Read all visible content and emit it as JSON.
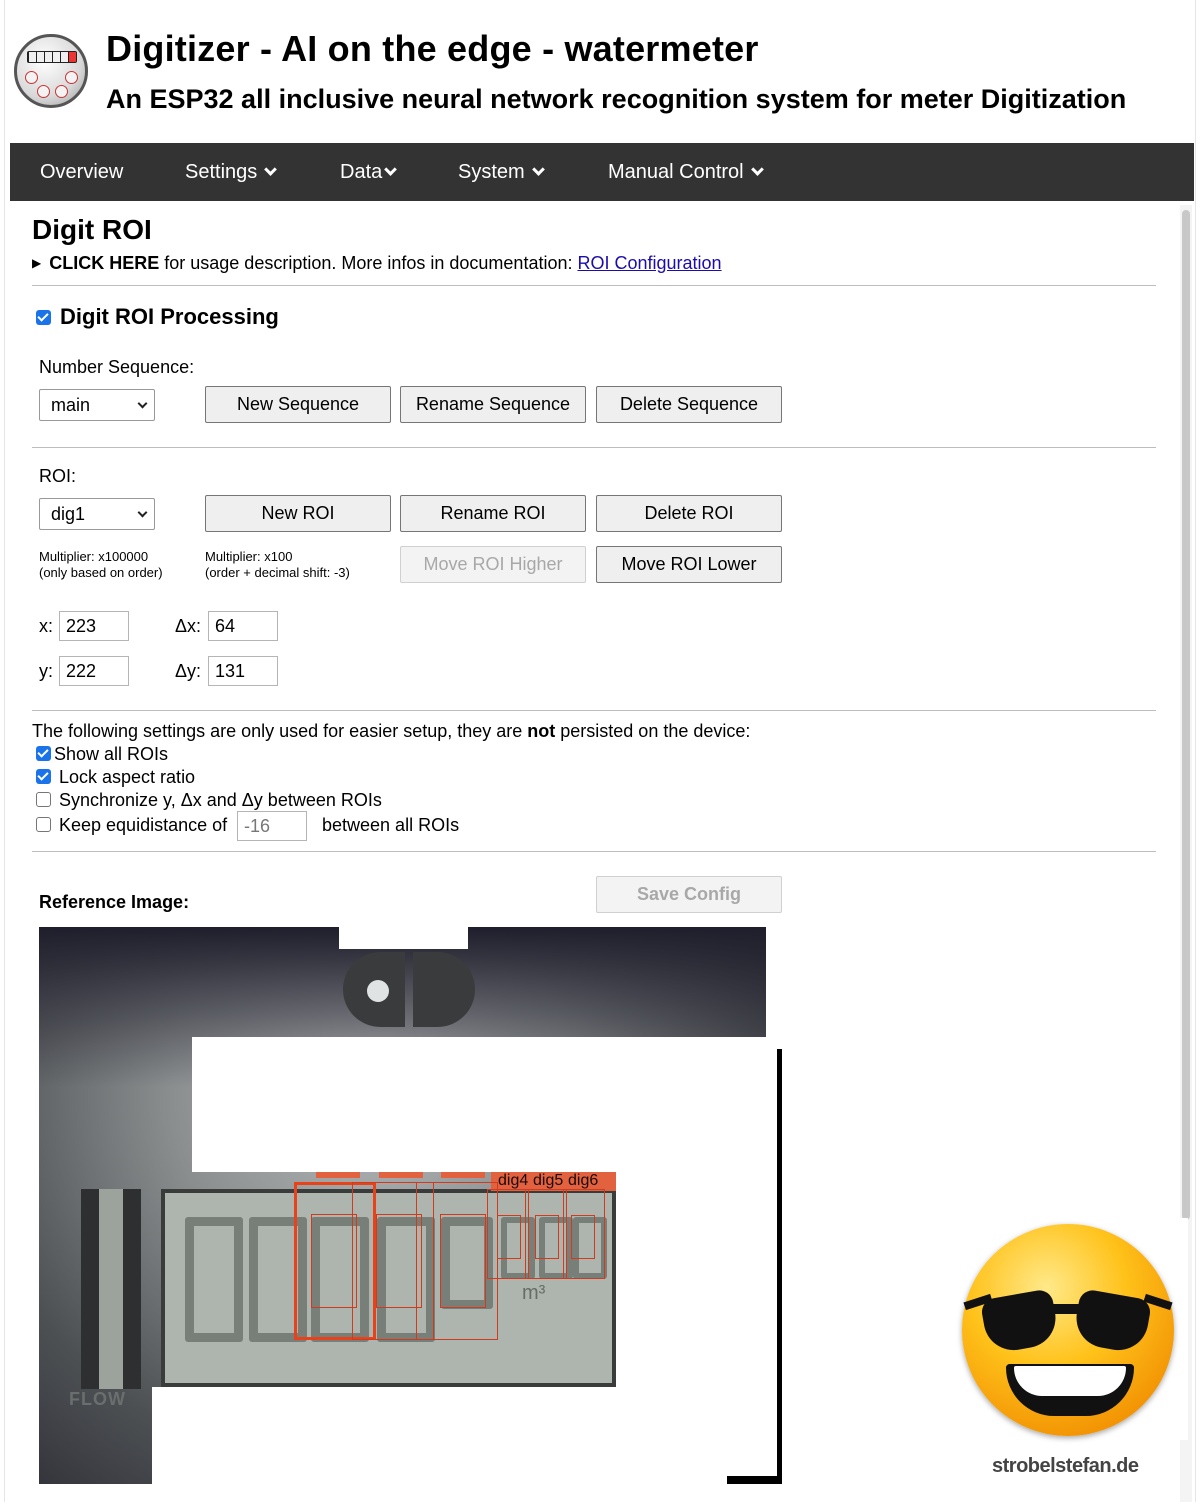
{
  "header": {
    "title": "Digitizer - AI on the edge - watermeter",
    "subtitle": "An ESP32 all inclusive neural network recognition system for meter Digitization",
    "logo_digits": "520001"
  },
  "nav": {
    "items": [
      {
        "label": "Overview",
        "dropdown": false
      },
      {
        "label": "Settings",
        "dropdown": true
      },
      {
        "label": "Data",
        "dropdown": true
      },
      {
        "label": "System",
        "dropdown": true
      },
      {
        "label": "Manual Control",
        "dropdown": true
      }
    ]
  },
  "page": {
    "title": "Digit ROI",
    "usage": {
      "click_here": "CLICK HERE",
      "text": " for usage description. More infos in documentation: ",
      "link": "ROI Configuration"
    }
  },
  "processing": {
    "label": "Digit ROI Processing",
    "checked": true
  },
  "sequence": {
    "label": "Number Sequence:",
    "selected": "main",
    "buttons": {
      "new": "New Sequence",
      "rename": "Rename Sequence",
      "delete": "Delete Sequence"
    }
  },
  "roi": {
    "label": "ROI:",
    "selected": "dig1",
    "buttons": {
      "new": "New ROI",
      "rename": "Rename ROI",
      "delete": "Delete ROI",
      "move_higher": "Move ROI Higher",
      "move_lower": "Move ROI Lower"
    },
    "multiplier_order": {
      "line1": "Multiplier: x100000",
      "line2": "(only based on order)"
    },
    "multiplier_shift": {
      "line1": "Multiplier: x100",
      "line2": "(order + decimal shift: -3)"
    },
    "x_label": "x:",
    "x": "223",
    "dx_label": "Δx:",
    "dx": "64",
    "y_label": "y:",
    "y": "222",
    "dy_label": "Δy:",
    "dy": "131"
  },
  "setup": {
    "note_pre": "The following settings are only used for easier setup, they are ",
    "note_bold": "not",
    "note_post": " persisted on the device:",
    "show_all": {
      "label": "Show all ROIs",
      "checked": true
    },
    "lock_aspect": {
      "label": "Lock aspect ratio",
      "checked": true
    },
    "sync": {
      "label": "Synchronize y, Δx and Δy between ROIs",
      "checked": false
    },
    "equidistance": {
      "label_pre": "Keep equidistance of",
      "value": "-16",
      "label_post": "between all ROIs",
      "checked": false
    }
  },
  "reference": {
    "label": "Reference Image:",
    "save_button": "Save Config",
    "roi_labels": [
      "dig4",
      "dig5",
      "dig6"
    ],
    "lcd_unit": "m³",
    "flow_text": "FLOW"
  },
  "smiley": {
    "credit": "strobelstefan.de"
  },
  "colors": {
    "nav_bg": "#333333",
    "link": "#1a0dab",
    "checkbox": "#1a73e8",
    "roi": "#e8421a"
  }
}
